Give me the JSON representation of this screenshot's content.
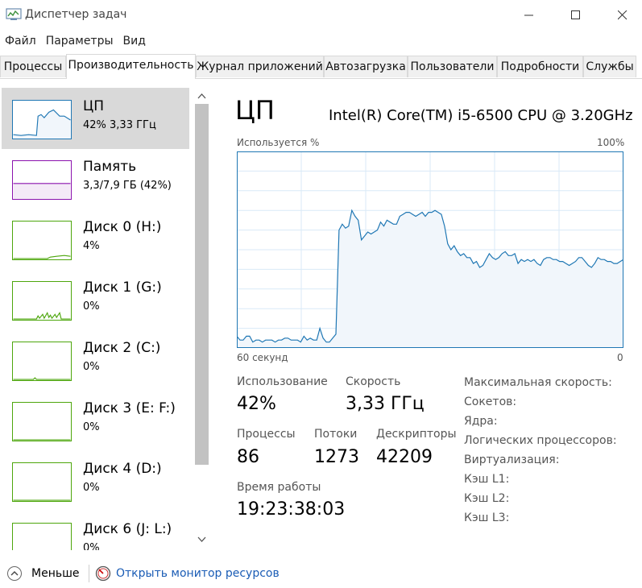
{
  "window": {
    "title": "Диспетчер задач"
  },
  "menu": [
    "Файл",
    "Параметры",
    "Вид"
  ],
  "tabs": [
    "Процессы",
    "Производительность",
    "Журнал приложений",
    "Автозагрузка",
    "Пользователи",
    "Подробности",
    "Службы"
  ],
  "sidebar": [
    {
      "name": "ЦП",
      "value": "42% 3,33 ГГц",
      "level": 0.42
    },
    {
      "name": "Память",
      "value": "3,3/7,9 ГБ (42%)",
      "level": 0.42
    },
    {
      "name": "Диск 0 (H:)",
      "value": "4%",
      "level": 0.04
    },
    {
      "name": "Диск 1 (G:)",
      "value": "0%",
      "level": 0.0
    },
    {
      "name": "Диск 2 (C:)",
      "value": "0%",
      "level": 0.0
    },
    {
      "name": "Диск 3 (E: F:)",
      "value": "0%",
      "level": 0.0
    },
    {
      "name": "Диск 4 (D:)",
      "value": "0%",
      "level": 0.0
    },
    {
      "name": "Диск 6 (J: L:)",
      "value": "0%",
      "level": 0.0
    }
  ],
  "main": {
    "title": "ЦП",
    "cpu_model": "Intel(R) Core(TM) i5-6500 CPU @ 3.20GHz",
    "graph_label": "Используется %",
    "graph_max": "100%",
    "graph_left": "60 секунд",
    "graph_right": "0"
  },
  "stats": {
    "usage_label": "Использование",
    "usage": "42%",
    "speed_label": "Скорость",
    "speed": "3,33 ГГц",
    "proc_label": "Процессы",
    "proc": "86",
    "threads_label": "Потоки",
    "threads": "1273",
    "handles_label": "Дескрипторы",
    "handles": "42209",
    "uptime_label": "Время работы",
    "uptime": "19:23:38:03"
  },
  "specs": [
    "Максимальная скорость:",
    "Сокетов:",
    "Ядра:",
    "Логических процессоров:",
    "Виртуализация:",
    "Кэш L1:",
    "Кэш L2:",
    "Кэш L3:"
  ],
  "footer": {
    "less": "Меньше",
    "monitor": "Открыть монитор ресурсов"
  },
  "colors": {
    "cpu_line": "#1f77b4",
    "cpu_fill": "#f1f6fb",
    "mem_line": "#8b12ae",
    "disk_line": "#4da60c",
    "selected": "#d9d9d9",
    "link": "#1a5cb5"
  },
  "chart_data": {
    "type": "area",
    "ylabel": "Используется %",
    "ylim": [
      0,
      100
    ],
    "x_range": [
      60,
      0
    ],
    "values": [
      6,
      4,
      4,
      6,
      6,
      3,
      4,
      4,
      3,
      4,
      4,
      4,
      3,
      4,
      4,
      5,
      5,
      4,
      4,
      4,
      3,
      6,
      4,
      5,
      4,
      4,
      10,
      5,
      3,
      3,
      5,
      7,
      60,
      63,
      61,
      62,
      70,
      67,
      65,
      55,
      57,
      59,
      58,
      59,
      60,
      64,
      62,
      65,
      64,
      63,
      63,
      67,
      68,
      69,
      69,
      68,
      67,
      68,
      69,
      67,
      69,
      69,
      70,
      69,
      68,
      62,
      53,
      50,
      52,
      49,
      47,
      48,
      46,
      46,
      43,
      44,
      41,
      42,
      45,
      48,
      46,
      45,
      46,
      48,
      49,
      47,
      47,
      48,
      43,
      45,
      44,
      45,
      44,
      45,
      43,
      42,
      45,
      46,
      46,
      45,
      45,
      44,
      44,
      43,
      42,
      43,
      44,
      46,
      46,
      44,
      42,
      41,
      43,
      46,
      45,
      45,
      44,
      44,
      43,
      43,
      44,
      45
    ]
  }
}
